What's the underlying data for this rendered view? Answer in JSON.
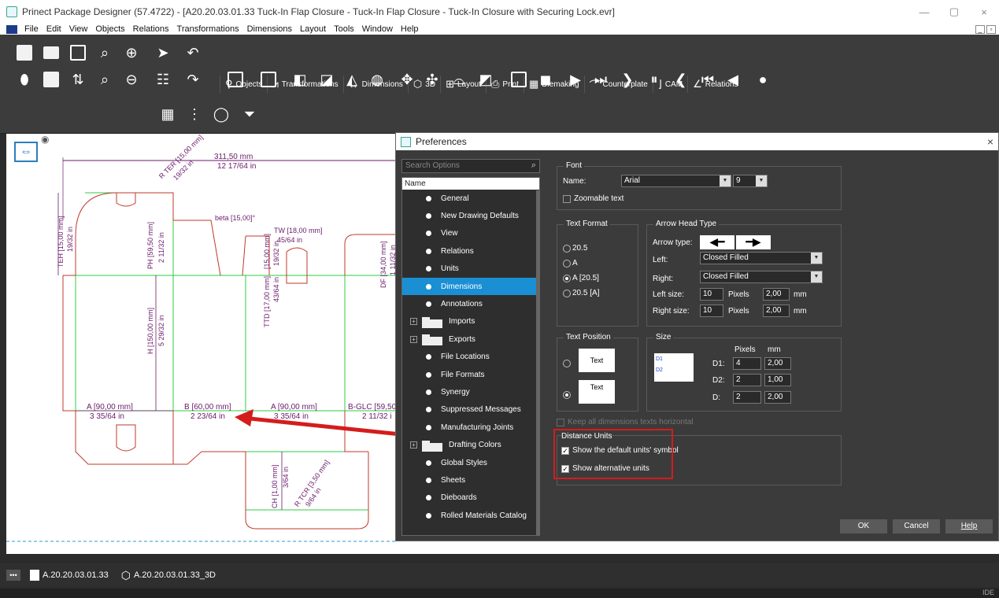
{
  "window": {
    "title": "Prinect Package Designer (57.4722) - [A20.20.03.01.33 Tuck-In Flap Closure - Tuck-In Flap Closure - Tuck-In Closure with Securing Lock.evr]",
    "min": "—",
    "restore": "▢",
    "close": "×"
  },
  "menu": [
    "File",
    "Edit",
    "View",
    "Objects",
    "Relations",
    "Transformations",
    "Dimensions",
    "Layout",
    "Tools",
    "Window",
    "Help"
  ],
  "tabs": [
    {
      "label": "Objects"
    },
    {
      "label": "Transformations"
    },
    {
      "label": "Dimensions"
    },
    {
      "label": "3D"
    },
    {
      "label": "Layout"
    },
    {
      "label": "Print"
    },
    {
      "label": "Diemaking"
    },
    {
      "label": "Counterplate"
    },
    {
      "label": "CAM"
    },
    {
      "label": "Relations"
    }
  ],
  "drawing": {
    "dims": {
      "total_mm": "311,50  mm",
      "total_in": "12 17/64 in",
      "r_teh": "R TER [15,00  mm]",
      "r_teh_in": "19/32  in",
      "beta": "beta [15,00]°",
      "tw": "TW [18,00  mm]",
      "tw_in": "45/64 in",
      "teh": "TEH [15,00  mm]",
      "teh_in": "19/32 in",
      "ph": "PH [59,50  mm]",
      "ph_in": "2 11/32 in",
      "ttd": "TTD [17,00  mm]",
      "ttd_in": "43/64 in",
      "tt": "[15,00  mm]",
      "tt_in": "19/32 in",
      "df": "DF [34,00  mm]",
      "df_in": "1 11/32 in",
      "h": "H [150,00  mm]",
      "h_in": "5 29/32 in",
      "a1": "A [90,00  mm]",
      "a1_in": "3 35/64 in",
      "b": "B [60,00  mm]",
      "b_in": "2 23/64 in",
      "a2": "A [90,00  mm]",
      "a2_in": "3 35/64 in",
      "bglc": "B-GLC [59,50",
      "bglc_in": "2 11/32 i",
      "ch": "CH [1,00  mm]",
      "ch_in": "3/64 in",
      "rtcr": "R TCR [3,50  mm]",
      "rtcr_in": "9/64 in"
    }
  },
  "doc_tabs": [
    "A.20.20.03.01.33",
    "A.20.20.03.01.33_3D"
  ],
  "status_right": "IDE",
  "dialog": {
    "title": "Preferences",
    "search_placeholder": "Search Options",
    "tree_header": "Name",
    "tree": [
      {
        "label": "General",
        "type": "leaf"
      },
      {
        "label": "New Drawing Defaults",
        "type": "leaf"
      },
      {
        "label": "View",
        "type": "leaf"
      },
      {
        "label": "Relations",
        "type": "leaf"
      },
      {
        "label": "Units",
        "type": "leaf"
      },
      {
        "label": "Dimensions",
        "type": "leaf",
        "selected": true
      },
      {
        "label": "Annotations",
        "type": "leaf"
      },
      {
        "label": "Imports",
        "type": "folder"
      },
      {
        "label": "Exports",
        "type": "folder"
      },
      {
        "label": "File Locations",
        "type": "leaf"
      },
      {
        "label": "File Formats",
        "type": "leaf"
      },
      {
        "label": "Synergy",
        "type": "leaf"
      },
      {
        "label": "Suppressed Messages",
        "type": "leaf"
      },
      {
        "label": "Manufacturing Joints",
        "type": "leaf"
      },
      {
        "label": "Drafting Colors",
        "type": "folder"
      },
      {
        "label": "Global Styles",
        "type": "leaf"
      },
      {
        "label": "Sheets",
        "type": "leaf"
      },
      {
        "label": "Dieboards",
        "type": "leaf"
      },
      {
        "label": "Rolled Materials Catalog",
        "type": "leaf"
      }
    ],
    "font": {
      "group": "Font",
      "name_label": "Name:",
      "name_value": "Arial",
      "size_value": "9",
      "zoomable": "Zoomable text"
    },
    "text_format": {
      "group": "Text Format",
      "options": [
        "20.5",
        "A",
        "A [20.5]",
        "20.5 [A]"
      ],
      "selected": 2
    },
    "arrow": {
      "group": "Arrow Head Type",
      "type_label": "Arrow type:",
      "left_label": "Left:",
      "left_value": "Closed Filled",
      "right_label": "Right:",
      "right_value": "Closed Filled",
      "left_size_label": "Left size:",
      "left_size_px": "10",
      "pixels": "Pixels",
      "left_size_mm": "2,00",
      "mm": "mm",
      "right_size_label": "Right size:",
      "right_size_px": "10",
      "right_size_mm": "2,00"
    },
    "text_position": {
      "group": "Text Position",
      "img1": "Text",
      "img2": "Text"
    },
    "size": {
      "group": "Size",
      "pixels": "Pixels",
      "mm": "mm",
      "d1": "D1:",
      "d1_px": "4",
      "d1_mm": "2,00",
      "d2": "D2:",
      "d2_px": "2",
      "d2_mm": "1,00",
      "d": "D:",
      "d_px": "2",
      "d_mm": "2,00",
      "d1_tag": "D1",
      "d2_tag": "D2"
    },
    "keep_horizontal": "Keep all dimensions texts horizontal",
    "distance_units": {
      "group": "Distance Units",
      "show_symbol": "Show the default units' symbol",
      "show_alt": "Show alternative units"
    },
    "buttons": {
      "ok": "OK",
      "cancel": "Cancel",
      "help": "Help"
    }
  },
  "colors": {
    "accent": "#1a8fd4",
    "cut": "#c0392b",
    "crease": "#2ecc40",
    "dim": "#6a1b6a",
    "highlight": "#d51c1c"
  }
}
